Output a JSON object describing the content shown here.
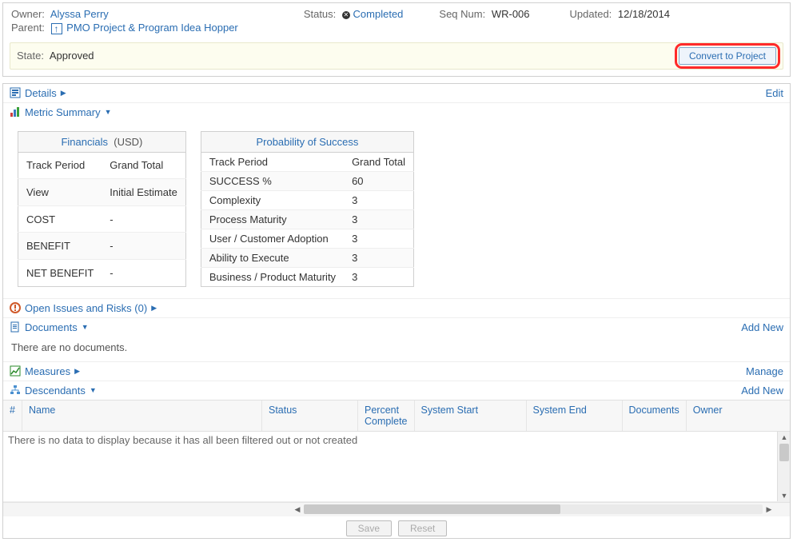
{
  "header": {
    "owner_label": "Owner:",
    "owner": "Alyssa Perry",
    "status_label": "Status:",
    "status": "Completed",
    "seq_label": "Seq Num:",
    "seq": "WR-006",
    "updated_label": "Updated:",
    "updated": "12/18/2014",
    "parent_label": "Parent:",
    "parent": "PMO Project & Program Idea Hopper",
    "state_label": "State:",
    "state": "Approved",
    "convert_btn": "Convert to Project"
  },
  "sections": {
    "details": {
      "title": "Details",
      "edit": "Edit"
    },
    "metric": {
      "title": "Metric Summary"
    },
    "issues": {
      "title": "Open Issues and Risks (0)"
    },
    "documents": {
      "title": "Documents",
      "add_new": "Add New",
      "empty": "There are no documents."
    },
    "measures": {
      "title": "Measures",
      "manage": "Manage"
    },
    "descendants": {
      "title": "Descendants",
      "add_new": "Add New"
    }
  },
  "financials": {
    "title": "Financials",
    "unit": "(USD)",
    "rows": [
      {
        "k": "Track Period",
        "v": "Grand Total"
      },
      {
        "k": "View",
        "v": "Initial Estimate"
      },
      {
        "k": "COST",
        "v": "-"
      },
      {
        "k": "BENEFIT",
        "v": "-"
      },
      {
        "k": "NET BENEFIT",
        "v": "-"
      }
    ]
  },
  "probability": {
    "title": "Probability of Success",
    "rows": [
      {
        "k": "Track Period",
        "v": "Grand Total"
      },
      {
        "k": "SUCCESS %",
        "v": "60"
      },
      {
        "k": "Complexity",
        "v": "3"
      },
      {
        "k": "Process Maturity",
        "v": "3"
      },
      {
        "k": "User / Customer Adoption",
        "v": "3"
      },
      {
        "k": "Ability to Execute",
        "v": "3"
      },
      {
        "k": "Business / Product Maturity",
        "v": "3"
      }
    ]
  },
  "grid": {
    "columns": {
      "hash": "#",
      "name": "Name",
      "status": "Status",
      "pct": "Percent Complete",
      "start": "System Start",
      "end": "System End",
      "docs": "Documents",
      "owner": "Owner"
    },
    "empty": "There is no data to display because it has all been filtered out or not created"
  },
  "footer": {
    "save": "Save",
    "reset": "Reset"
  }
}
